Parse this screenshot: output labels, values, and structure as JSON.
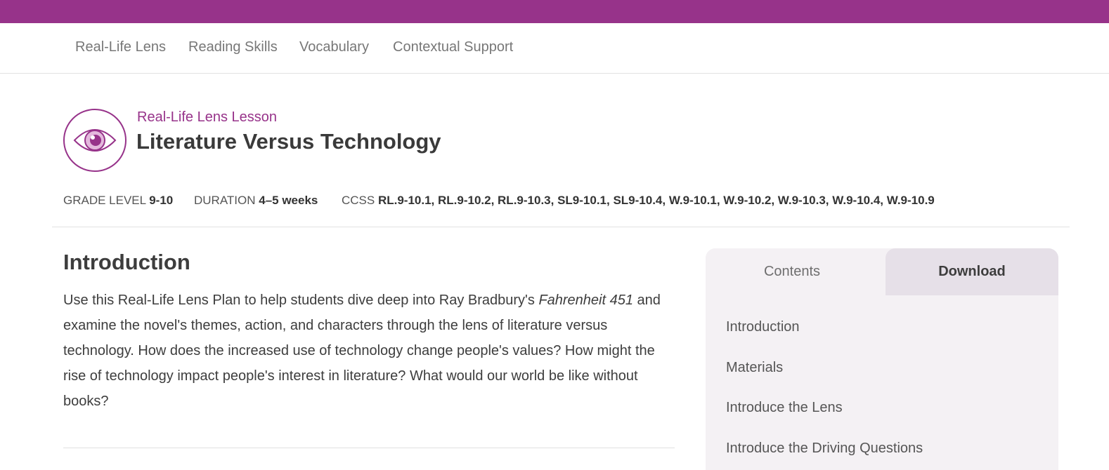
{
  "colors": {
    "brand": "#97338a",
    "panel": "#f4f1f4",
    "active_tab": "#e6e0e8"
  },
  "subnav": {
    "items": [
      {
        "label": "Real-Life Lens"
      },
      {
        "label": "Reading Skills"
      },
      {
        "label": "Vocabulary"
      },
      {
        "label": "Contextual Support"
      }
    ]
  },
  "lesson": {
    "icon": "eye-icon",
    "eyebrow": "Real-Life Lens Lesson",
    "title": "Literature Versus Technology"
  },
  "meta": {
    "grade_label": "GRADE LEVEL",
    "grade_value": "9-10",
    "duration_label": "DURATION",
    "duration_value": "4–5 weeks",
    "ccss_label": "CCSS",
    "ccss_value": "RL.9-10.1, RL.9-10.2, RL.9-10.3, SL9-10.1, SL9-10.4, W.9-10.1, W.9-10.2, W.9-10.3, W.9-10.4, W.9-10.9"
  },
  "intro": {
    "heading": "Introduction",
    "body_part1": "Use this Real-Life Lens Plan to help students dive deep into Ray Bradbury's ",
    "book_title": "Fahrenheit 451",
    "body_part2": " and examine the novel's themes, action, and characters through the lens of literature versus technology. How does the increased use of technology change people's values? How might the rise of technology impact people's interest in literature? What would our world be like without books?"
  },
  "sidebar": {
    "tabs": [
      {
        "label": "Contents"
      },
      {
        "label": "Download"
      }
    ],
    "toc": [
      {
        "label": "Introduction"
      },
      {
        "label": "Materials"
      },
      {
        "label": "Introduce the Lens"
      },
      {
        "label": "Introduce the Driving Questions"
      }
    ]
  }
}
